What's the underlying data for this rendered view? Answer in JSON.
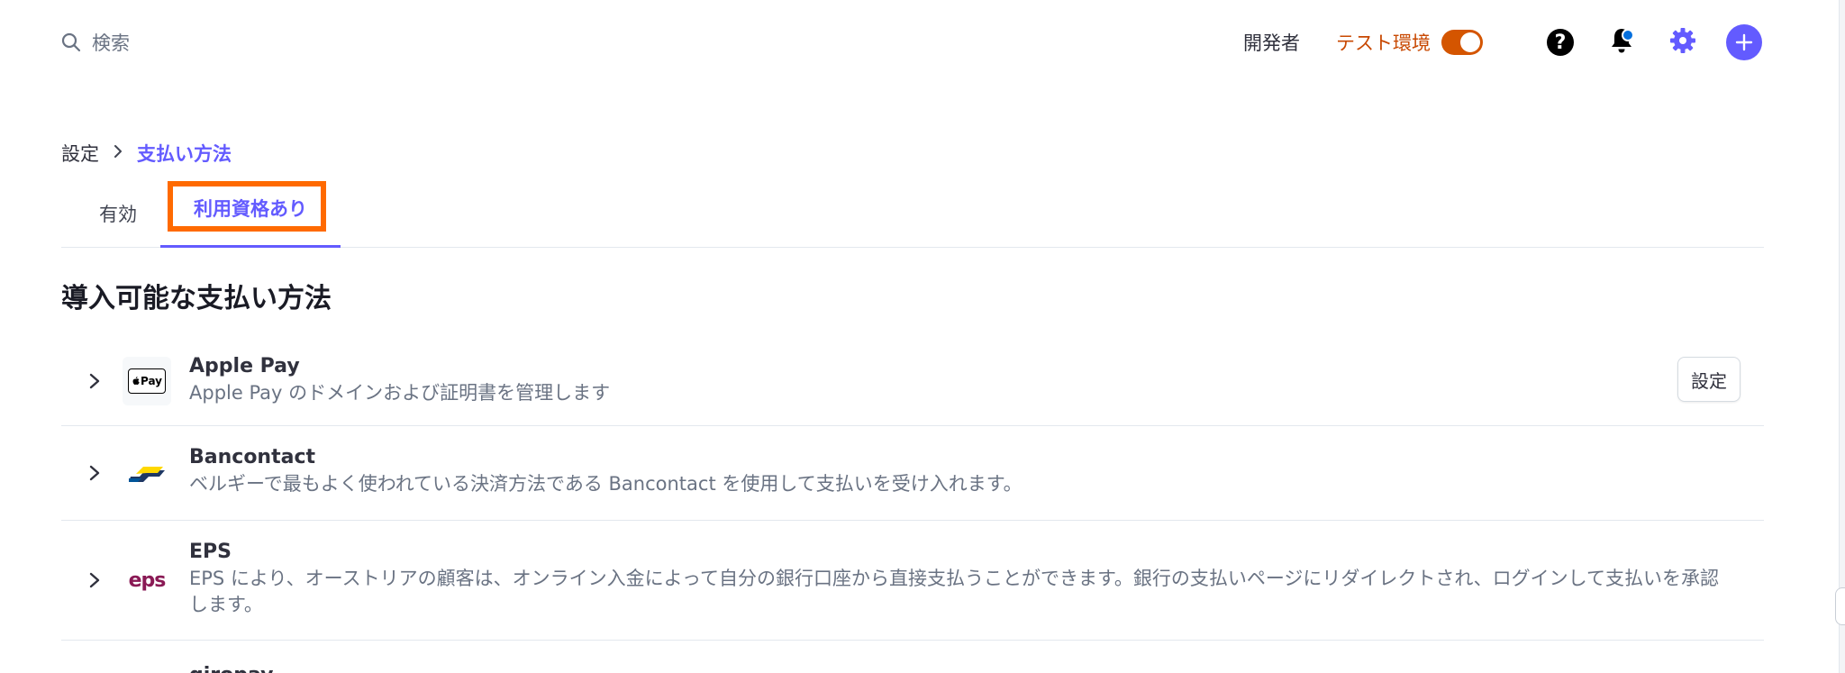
{
  "search": {
    "placeholder": "検索",
    "icon": "search-icon"
  },
  "header": {
    "developers_label": "開発者",
    "test_mode_label": "テスト環境",
    "test_mode_on": true,
    "test_mode_color": "#d45500",
    "accent_color": "#635bff"
  },
  "breadcrumb": {
    "root": "設定",
    "current": "支払い方法"
  },
  "tabs": [
    {
      "label": "有効",
      "selected": false
    },
    {
      "label": "利用資格あり",
      "selected": true
    }
  ],
  "section": {
    "title": "導入可能な支払い方法"
  },
  "payment_methods": [
    {
      "name": "Apple Pay",
      "description": "Apple Pay のドメインおよび証明書を管理します",
      "logo_text": "Pay",
      "action_label": "設定"
    },
    {
      "name": "Bancontact",
      "description": "ベルギーで最もよく使われている決済方法である Bancontact を使用して支払いを受け入れます。"
    },
    {
      "name": "EPS",
      "description": "EPS により、オーストリアの顧客は、オンライン入金によって自分の銀行口座から直接支払うことができます。銀行の支払いページにリダイレクトされ、ログインして支払いを承認します。",
      "logo_text": "eps"
    },
    {
      "name": "giropay"
    }
  ]
}
